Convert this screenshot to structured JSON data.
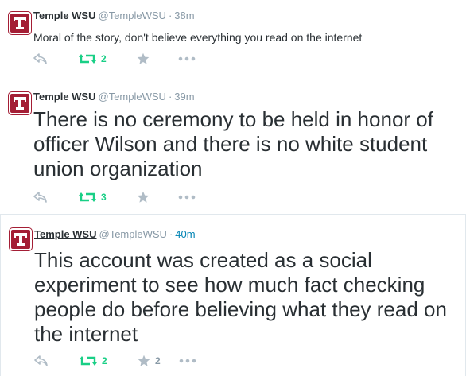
{
  "colors": {
    "avatar_bg": "#a41e35",
    "retweet_active": "#19cf86",
    "muted": "#8899a6",
    "link": "#0084b4"
  },
  "tweets": [
    {
      "fullname": "Temple WSU",
      "username": "@TempleWSU",
      "separator": "·",
      "time": "38m",
      "text": "Moral of the story, don't believe everything you read on the internet",
      "retweets": "2",
      "favorites": "",
      "icons": [
        "temple-logo-icon",
        "reply-icon",
        "retweet-icon",
        "star-icon",
        "more-icon"
      ]
    },
    {
      "fullname": "Temple WSU",
      "username": "@TempleWSU",
      "separator": "·",
      "time": "39m",
      "text": "There is no ceremony to be held in honor of officer Wilson and there is no white student union organization",
      "retweets": "3",
      "favorites": "",
      "icons": [
        "temple-logo-icon",
        "reply-icon",
        "retweet-icon",
        "star-icon",
        "more-icon"
      ]
    },
    {
      "fullname": "Temple WSU",
      "username": "@TempleWSU",
      "separator": "·",
      "time": "40m",
      "text": "This account was created as a social experiment to see how much fact checking people do before believing what they read on the internet",
      "retweets": "2",
      "favorites": "2",
      "icons": [
        "temple-logo-icon",
        "reply-icon",
        "retweet-icon",
        "star-icon",
        "more-icon"
      ]
    }
  ]
}
